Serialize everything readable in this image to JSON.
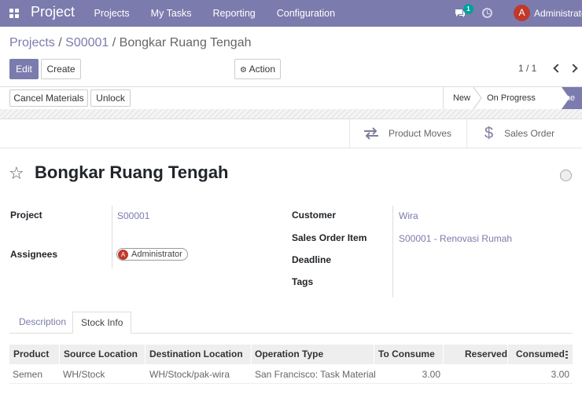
{
  "navbar": {
    "brand": "Project",
    "menu": [
      "Projects",
      "My Tasks",
      "Reporting",
      "Configuration"
    ],
    "chat_count": "1",
    "user_initial": "A",
    "user_name": "Administrator"
  },
  "breadcrumb": {
    "parent1": "Projects",
    "sep1": " / ",
    "parent2": "S00001",
    "sep2": " / ",
    "current": "Bongkar Ruang Tengah"
  },
  "toolbar": {
    "edit_label": "Edit",
    "create_label": "Create",
    "action_label": "Action",
    "pager": "1 / 1"
  },
  "statusbar": {
    "buttons": [
      "Cancel Materials",
      "Unlock"
    ],
    "stages": [
      "New",
      "On Progress",
      "Done"
    ],
    "active_stage": "Done"
  },
  "smart_buttons": {
    "product_moves": "Product Moves",
    "sales_order": "Sales Order"
  },
  "record": {
    "title": "Bongkar Ruang Tengah"
  },
  "fields": {
    "project_label": "Project",
    "project_value": "S00001",
    "assignees_label": "Assignees",
    "assignee_initial": "A",
    "assignee_name": "Administrator",
    "customer_label": "Customer",
    "customer_value": "Wira",
    "sales_order_item_label": "Sales Order Item",
    "sales_order_item_value": "S00001 - Renovasi Rumah",
    "deadline_label": "Deadline",
    "tags_label": "Tags"
  },
  "tabs": [
    "Description",
    "Stock Info"
  ],
  "active_tab": "Stock Info",
  "table": {
    "columns": [
      "Product",
      "Source Location",
      "Destination Location",
      "Operation Type",
      "To Consume",
      "Reserved",
      "Consumed"
    ],
    "rows": [
      [
        "Semen",
        "WH/Stock",
        "WH/Stock/pak-wira",
        "San Francisco: Task Material",
        "3.00",
        "",
        "3.00"
      ]
    ]
  },
  "colors": {
    "brand": "#7C7BAD",
    "badge": "#00A09D",
    "avatar": "#C0392B"
  }
}
